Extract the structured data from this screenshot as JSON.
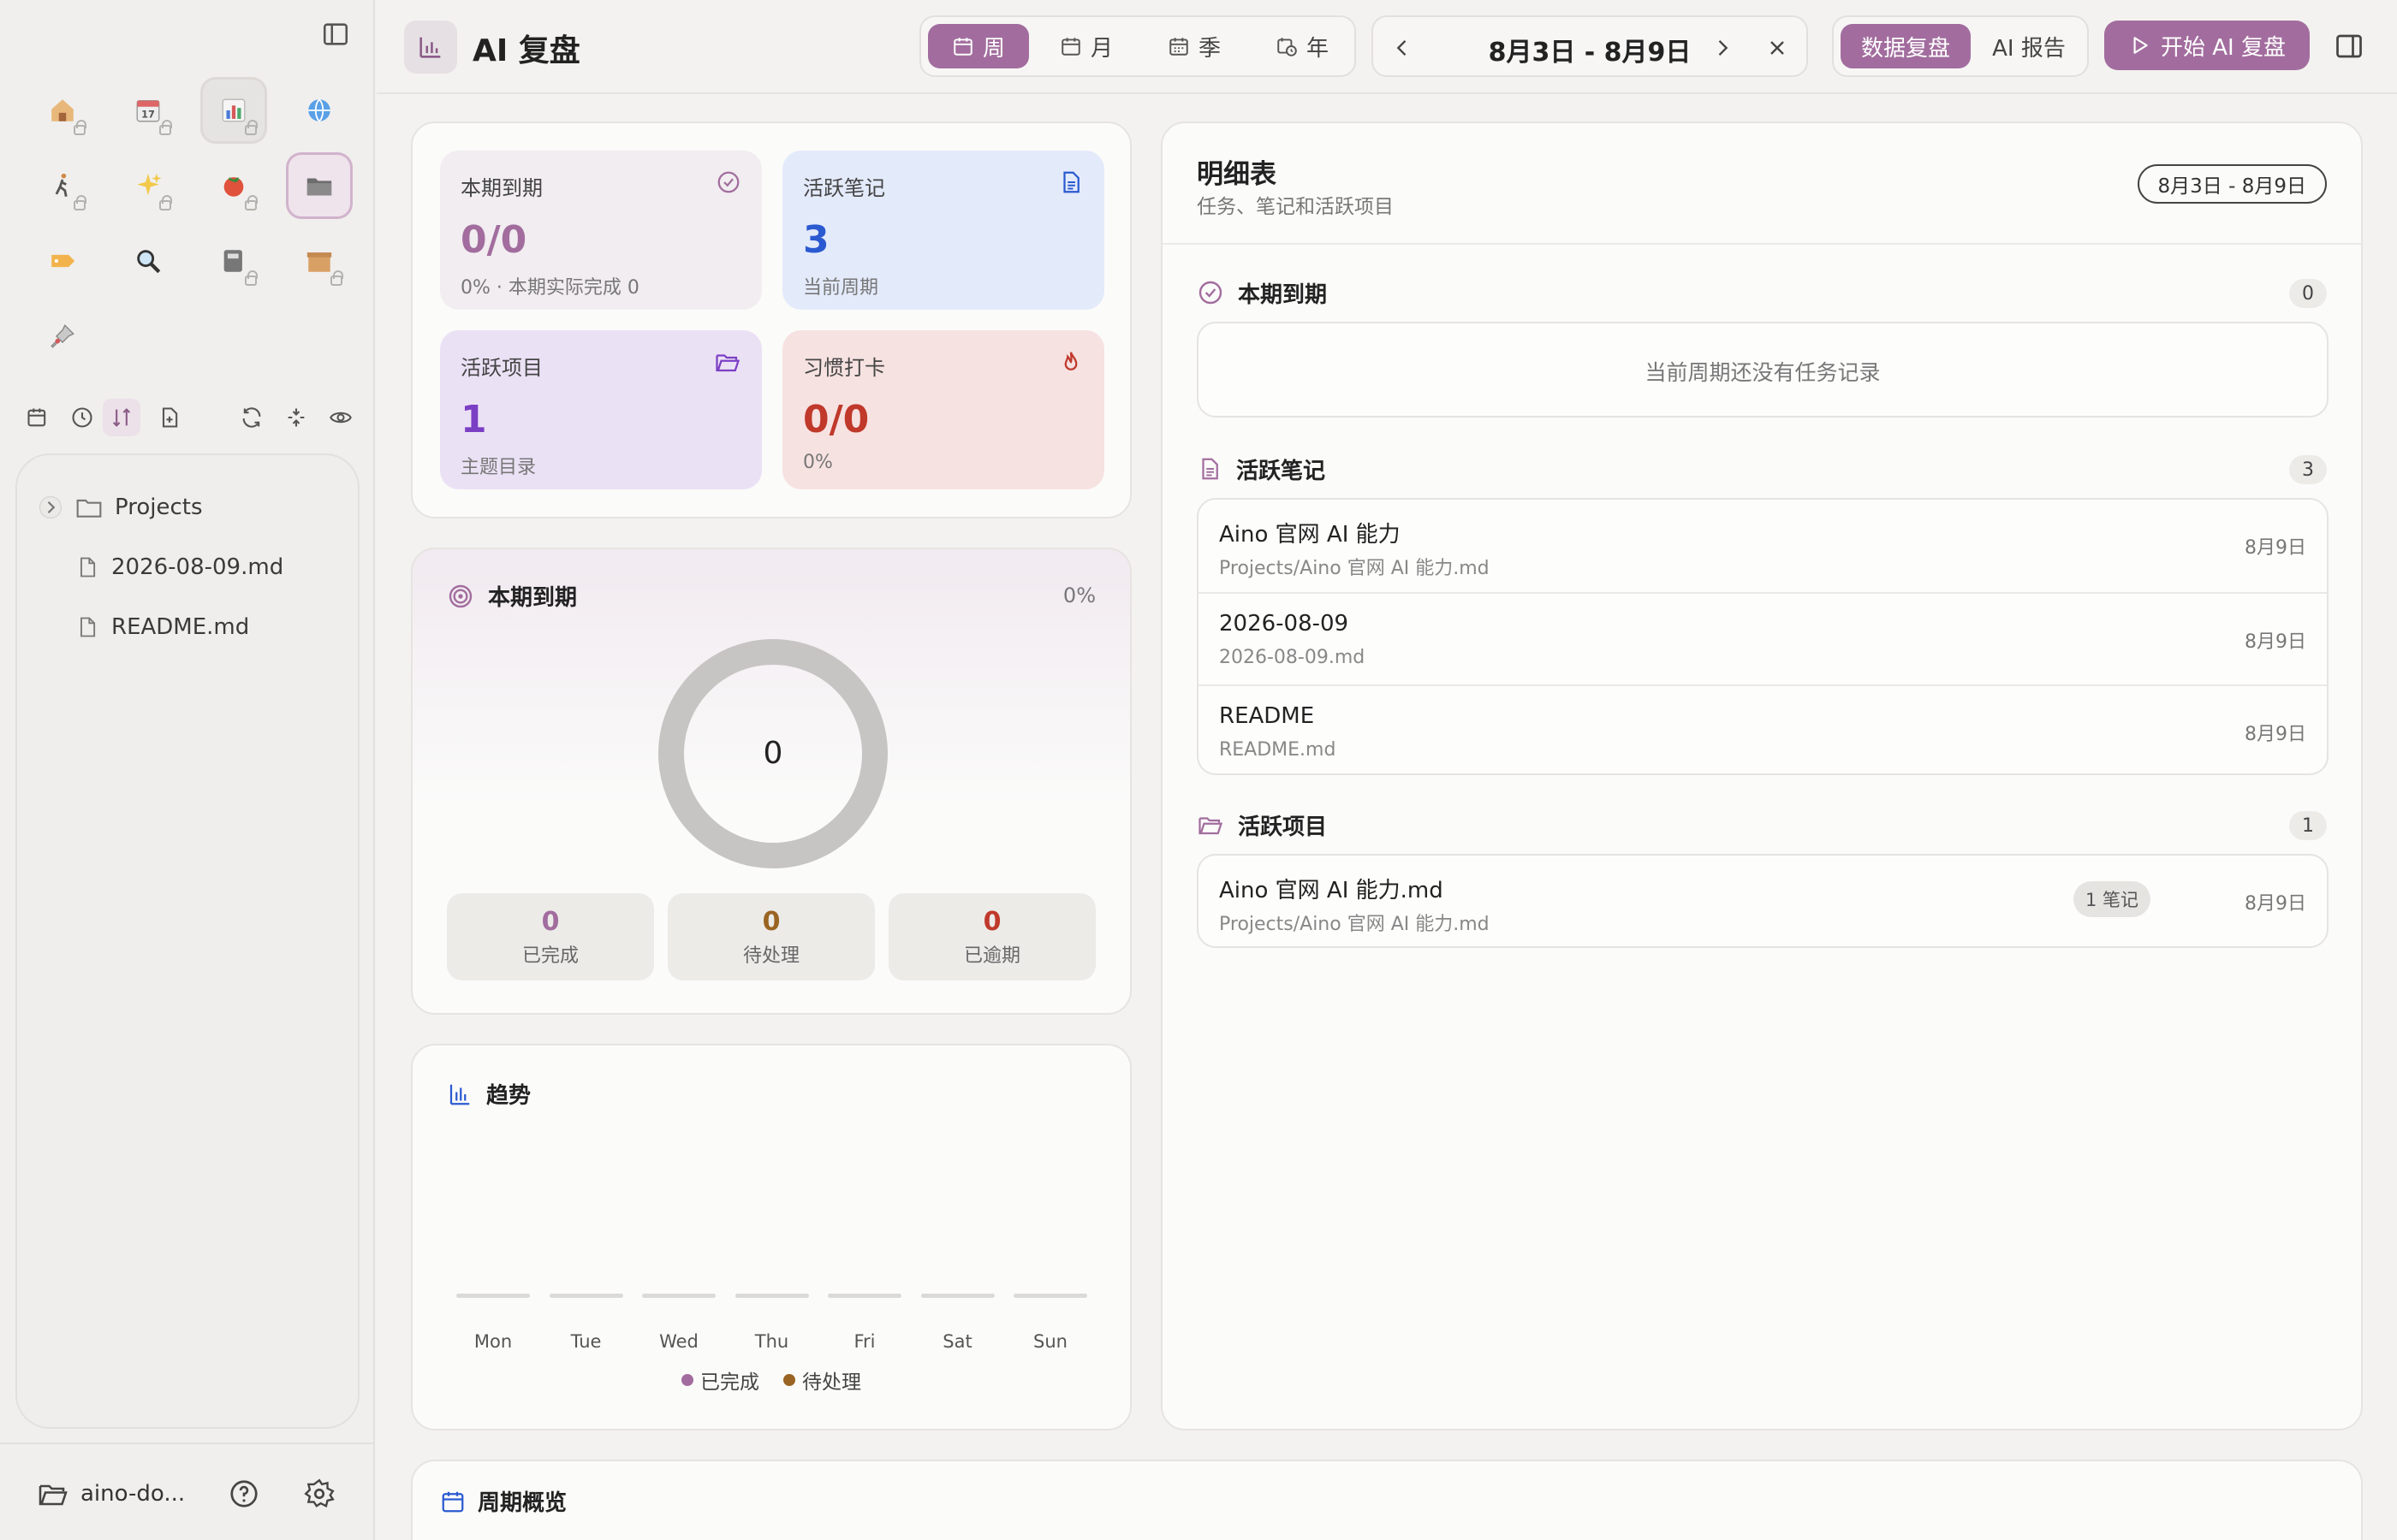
{
  "colors": {
    "accent": "#a26d9e",
    "blue": "#2b5ad0",
    "purple": "#7b3fc4",
    "red": "#c0392b",
    "pending": "#9a6422"
  },
  "sidebar": {
    "apps": [
      {
        "icon": "home-icon"
      },
      {
        "icon": "calendar-icon"
      },
      {
        "icon": "chart-icon"
      },
      {
        "icon": "globe-icon"
      },
      {
        "icon": "walking-icon"
      },
      {
        "icon": "sparkles-icon"
      },
      {
        "icon": "tomato-icon"
      },
      {
        "icon": "folder-icon"
      },
      {
        "icon": "tag-icon"
      },
      {
        "icon": "magnifier-icon"
      },
      {
        "icon": "notebook-icon"
      },
      {
        "icon": "box-icon"
      },
      {
        "icon": "pin-icon"
      }
    ],
    "tree": [
      {
        "label": "Projects",
        "type": "folder"
      },
      {
        "label": "2026-08-09.md",
        "type": "file"
      },
      {
        "label": "README.md",
        "type": "file"
      }
    ],
    "workspace": "aino-do..."
  },
  "header": {
    "title": "AI 复盘",
    "periods": [
      "周",
      "月",
      "季",
      "年"
    ],
    "active_period": "周",
    "date_range": "8月3日 - 8月9日",
    "view_tabs": [
      "数据复盘",
      "AI 报告"
    ],
    "start_button": "开始 AI 复盘"
  },
  "stats": [
    {
      "label": "本期到期",
      "value": "0/0",
      "sub": "0% · 本期实际完成 0"
    },
    {
      "label": "活跃笔记",
      "value": "3",
      "sub": "当前周期"
    },
    {
      "label": "活跃项目",
      "value": "1",
      "sub": "主题目录"
    },
    {
      "label": "习惯打卡",
      "value": "0/0",
      "sub": "0%"
    }
  ],
  "due": {
    "title": "本期到期",
    "percent": "0%",
    "center": "0",
    "completed_value": "0",
    "completed_label": "已完成",
    "pending_value": "0",
    "pending_label": "待处理",
    "overdue_value": "0",
    "overdue_label": "已逾期"
  },
  "trend": {
    "title": "趋势",
    "legend": [
      "已完成",
      "待处理"
    ]
  },
  "chart_data": {
    "type": "bar",
    "categories": [
      "Mon",
      "Tue",
      "Wed",
      "Thu",
      "Fri",
      "Sat",
      "Sun"
    ],
    "series": [
      {
        "name": "已完成",
        "values": [
          0,
          0,
          0,
          0,
          0,
          0,
          0
        ]
      },
      {
        "name": "待处理",
        "values": [
          0,
          0,
          0,
          0,
          0,
          0,
          0
        ]
      }
    ]
  },
  "detail": {
    "title": "明细表",
    "subtitle": "任务、笔记和活跃项目",
    "range": "8月3日 - 8月9日",
    "due_section": {
      "title": "本期到期",
      "count": "0",
      "empty": "当前周期还没有任务记录"
    },
    "notes_section": {
      "title": "活跃笔记",
      "count": "3",
      "rows": [
        {
          "name": "Aino 官网 AI 能力",
          "path": "Projects/Aino 官网 AI 能力.md",
          "date": "8月9日"
        },
        {
          "name": "2026-08-09",
          "path": "2026-08-09.md",
          "date": "8月9日"
        },
        {
          "name": "README",
          "path": "README.md",
          "date": "8月9日"
        }
      ]
    },
    "projects_section": {
      "title": "活跃项目",
      "count": "1",
      "rows": [
        {
          "name": "Aino 官网 AI 能力.md",
          "path": "Projects/Aino 官网 AI 能力.md",
          "badge": "1 笔记",
          "date": "8月9日"
        }
      ]
    }
  },
  "overview": {
    "title": "周期概览"
  }
}
